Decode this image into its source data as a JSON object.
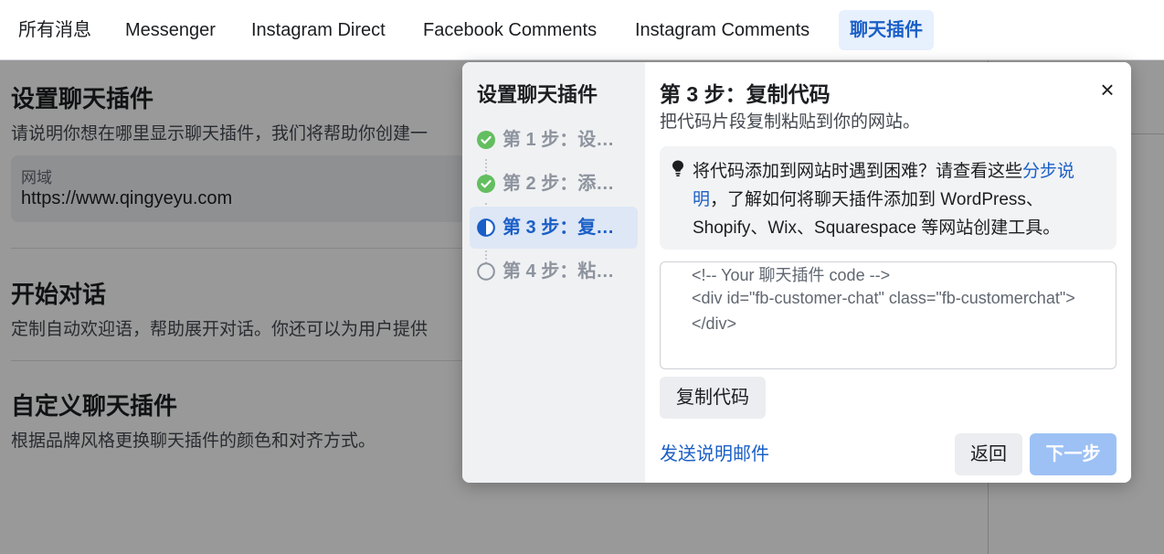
{
  "tabs": [
    {
      "label": "所有消息"
    },
    {
      "label": "Messenger"
    },
    {
      "label": "Instagram Direct"
    },
    {
      "label": "Facebook Comments"
    },
    {
      "label": "Instagram Comments"
    },
    {
      "label": "聊天插件",
      "active": true
    }
  ],
  "page": {
    "setup": {
      "title": "设置聊天插件",
      "description": "请说明你想在哪里显示聊天插件，我们将帮助你创建一"
    },
    "domain": {
      "label": "网域",
      "value": "https://www.qingyeyu.com"
    },
    "start": {
      "title": "开始对话",
      "description": "定制自动欢迎语，帮助展开对话。你还可以为用户提供"
    },
    "customize": {
      "title": "自定义聊天插件",
      "description": "根据品牌风格更换聊天插件的颜色和对齐方式。"
    }
  },
  "modal": {
    "stepper_title": "设置聊天插件",
    "steps": [
      {
        "label": "第 1 步：设…",
        "status": "done"
      },
      {
        "label": "第 2 步：添…",
        "status": "done"
      },
      {
        "label": "第 3 步：复…",
        "status": "current"
      },
      {
        "label": "第 4 步：粘…",
        "status": "pending"
      }
    ],
    "title": "第 3 步：复制代码",
    "subtitle": "把代码片段复制粘贴到你的网站。",
    "close_symbol": "×",
    "tip": {
      "text_before": "将代码添加到网站时遇到困难？请查看这些",
      "link": "分步说明",
      "text_after": "，了解如何将聊天插件添加到 WordPress、Shopify、Wix、Squarespace 等网站创建工具。"
    },
    "code_lines": [
      "<!-- Your 聊天插件 code -->",
      "<div id=\"fb-customer-chat\" class=\"fb-customerchat\">",
      "</div>"
    ],
    "copy_button": "复制代码",
    "email_link": "发送说明邮件",
    "back_button": "返回",
    "next_button": "下一步"
  },
  "colors": {
    "accent": "#1a5fc7",
    "success": "#63be5f",
    "next_disabled": "#9dc1f5"
  },
  "icons": {
    "done": "check-circle-icon",
    "current": "half-circle-icon",
    "pending": "empty-circle-icon",
    "tip": "lightbulb-icon",
    "close": "close-icon"
  }
}
